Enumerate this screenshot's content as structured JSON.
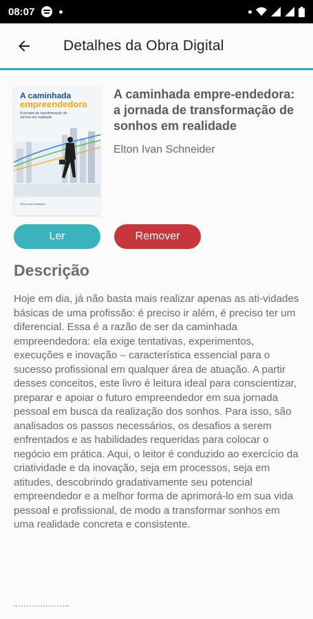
{
  "status_bar": {
    "time": "08:07"
  },
  "header": {
    "title": "Detalhes da Obra Digital"
  },
  "book": {
    "cover": {
      "title_line1": "A caminhada",
      "title_line2": "empreendedora",
      "subtitle": "A jornada de transformação de sonhos em realidade",
      "author": "Elton Ivan Schneider"
    },
    "title": "A caminhada empre-endedora: a jornada de transformação de sonhos em realidade",
    "author": "Elton Ivan Schneider"
  },
  "actions": {
    "read_label": "Ler",
    "remove_label": "Remover"
  },
  "description": {
    "heading": "Descrição",
    "text": "Hoje em dia, já não basta mais realizar apenas as ati-vidades básicas de uma profissão: é preciso ir além, é preciso ter um diferencial. Essa é a razão de ser da caminhada empreendedora: ela exige tentativas, experimentos, execuções e inovação – característica essencial para o sucesso profissional em qualquer área de atuação. A partir desses conceitos, este livro é leitura ideal para conscientizar, preparar e apoiar o futuro empreendedor em sua jornada pessoal em busca da realização dos sonhos. Para isso, são analisados os passos necessários, os desafios a serem enfrentados e as habilidades requeridas para colocar o negócio em prática. Aqui, o leitor é conduzido ao exercício da criatividade e da inovação, seja em processos, seja em atitudes, descobrindo gradativamente seu potencial empreendedor e a melhor forma de aprimorá-lo em sua vida pessoal e profissional, de modo a transformar sonhos em uma realidade concreta e consistente."
  },
  "colors": {
    "accent": "#3bb2bd",
    "danger": "#c5373d",
    "divider": "#35a9b3"
  }
}
